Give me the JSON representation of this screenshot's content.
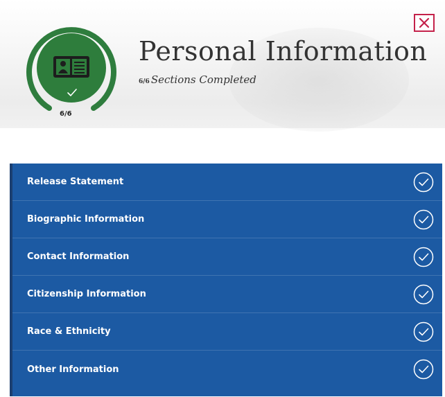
{
  "header": {
    "title": "Personal Information",
    "progress_fraction": "6/6",
    "subtitle": "Sections Completed",
    "progress_value": 1.0,
    "ring_count": "6/6"
  },
  "close_icon": "close-icon",
  "colors": {
    "ring": "#2f7d3e",
    "badge": "#2e7d3c",
    "panel": "#1c5aa3",
    "close": "#c4214a"
  },
  "sections": [
    {
      "label": "Release Statement",
      "status": "complete"
    },
    {
      "label": "Biographic Information",
      "status": "complete"
    },
    {
      "label": "Contact Information",
      "status": "complete"
    },
    {
      "label": "Citizenship Information",
      "status": "complete"
    },
    {
      "label": "Race & Ethnicity",
      "status": "complete"
    },
    {
      "label": "Other Information",
      "status": "complete"
    }
  ]
}
